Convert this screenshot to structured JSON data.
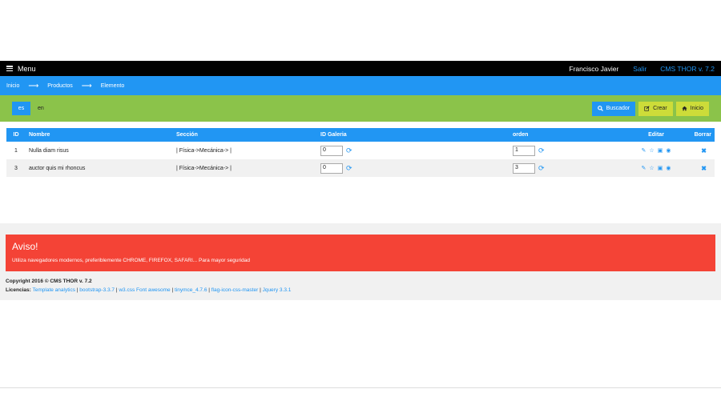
{
  "topbar": {
    "menu_label": "Menu",
    "user": "Francisco Javier",
    "logout": "Salir",
    "version": "CMS THOR v. 7.2"
  },
  "breadcrumb": {
    "items": [
      "Inicio",
      "Productos",
      "Elemento"
    ],
    "separator": "⟶"
  },
  "toolbar": {
    "languages": [
      "es",
      "en"
    ],
    "active_language": "es",
    "search_label": "Buscador",
    "create_label": "Crear",
    "home_label": "Inicio"
  },
  "table": {
    "headers": [
      "ID",
      "Nombre",
      "Sección",
      "ID Galeria",
      "orden",
      "Editar",
      "Borrar"
    ],
    "rows": [
      {
        "id": "1",
        "nombre": "Nulla diam risus",
        "seccion": "| Física->Mecánica-> |",
        "galeria": "0",
        "orden": "1"
      },
      {
        "id": "3",
        "nombre": "auctor quis mi rhoncus",
        "seccion": "| Física->Mecánica-> |",
        "galeria": "0",
        "orden": "3"
      }
    ]
  },
  "footer": {
    "aviso_title": "Aviso!",
    "aviso_text": "Utiliza navegadores modernos, preferiblemente CHROME, FIREFOX, SAFARI... Para mayor seguridad",
    "copyright": "Copyright 2016 © CMS THOR v. 7.2",
    "licencias_label": "Licencias:",
    "licencias": [
      "Template analytics",
      "bootstrap-3.3.7",
      "w3.css Font awesome",
      "tinymce_4.7.6",
      "flag-icon-css-master",
      "Jquery 3.3.1"
    ]
  },
  "colors": {
    "primary_blue": "#2196F3",
    "green": "#8BC34A",
    "lime": "#CDDC39",
    "red": "#f44336"
  }
}
